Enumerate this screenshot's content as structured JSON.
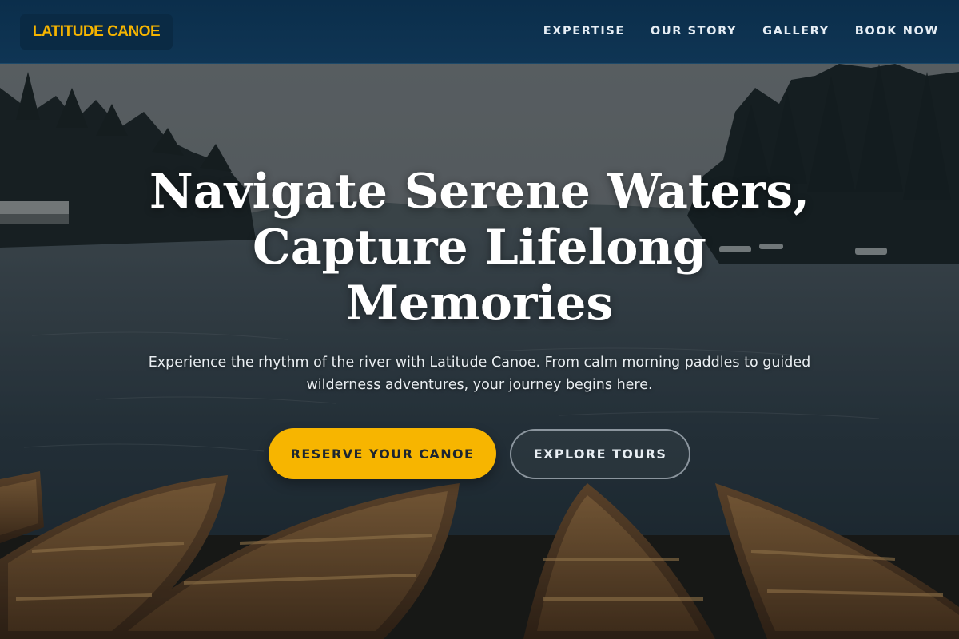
{
  "nav": {
    "brand": "LATITUDE CANOE",
    "links": [
      "EXPERTISE",
      "OUR STORY",
      "GALLERY",
      "BOOK NOW"
    ]
  },
  "hero": {
    "headline_lines": [
      "Navigate Serene Waters,",
      "Capture Lifelong",
      "Memories"
    ],
    "subtext": "Experience the rhythm of the river with Latitude Canoe. From calm morning paddles to guided wilderness adventures, your journey begins here.",
    "primary_cta": "RESERVE YOUR CANOE",
    "secondary_cta": "EXPLORE TOURS",
    "image": "lake-with-canoes-photo"
  },
  "colors": {
    "brand": "#f5b400",
    "nav_bg": "#0b2e4b",
    "primary_button": "#f7b500"
  }
}
